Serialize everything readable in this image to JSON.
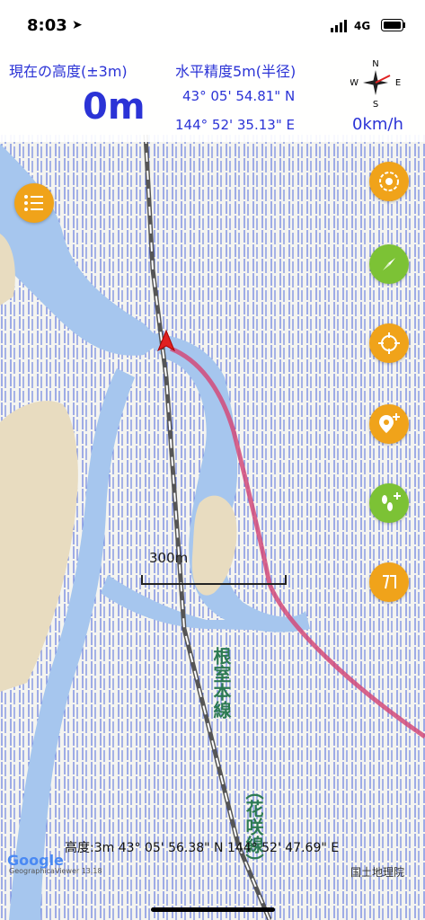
{
  "status_bar": {
    "time": "8:03",
    "network": "4G"
  },
  "header": {
    "altitude_label": "現在の高度(±3m)",
    "altitude_value": "0m",
    "accuracy_label": "水平精度5m(半径)",
    "latitude": "43° 05' 54.81\" N",
    "longitude": "144° 52' 35.13\" E",
    "speed": "0km/h"
  },
  "map": {
    "scale_label": "300m",
    "rail_label_1": "根室本線",
    "rail_label_2": "（花咲線）",
    "bottom_info": "高度:3m  43° 05' 56.38\" N 144° 52' 47.69\" E",
    "attribution": "国土地理院",
    "google_logo": "Google",
    "google_sub": "GeographicaViewer 13.18"
  },
  "buttons": [
    {
      "name": "layers-button",
      "icon": "swirl-icon",
      "color": "#f0a31a"
    },
    {
      "name": "compass-mode-button",
      "icon": "compass-needle-icon",
      "color": "#7cc235"
    },
    {
      "name": "current-location-button",
      "icon": "crosshair-icon",
      "color": "#f0a31a"
    },
    {
      "name": "add-pin-button",
      "icon": "map-pin-plus-icon",
      "color": "#f0a31a"
    },
    {
      "name": "add-track-button",
      "icon": "footprints-plus-icon",
      "color": "#7cc235"
    },
    {
      "name": "unit-toggle-button",
      "icon": "text-icon",
      "color": "#f0a31a"
    }
  ],
  "menu_button": {
    "icon": "list-icon",
    "color": "#f0a31a"
  },
  "colors": {
    "accent_text": "#2b33d6",
    "water": "#a6c6ee",
    "marsh": "#3a57d8",
    "track": "#d24a79",
    "rail": "#555555"
  }
}
